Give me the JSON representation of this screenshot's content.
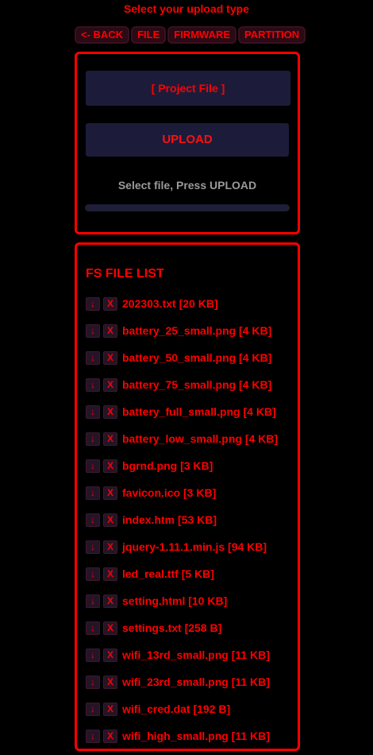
{
  "header": {
    "title": "Select your upload type"
  },
  "nav": {
    "back_label": "<- BACK",
    "file_label": "FILE",
    "firmware_label": "FIRMWARE",
    "partition_label": "PARTITION"
  },
  "upload": {
    "project_file_label": "[ Project File ]",
    "upload_label": "UPLOAD",
    "status": "Select file, Press UPLOAD",
    "progress_fraction": 0
  },
  "file_list": {
    "title": "FS FILE LIST",
    "download_label": "↓",
    "delete_label": "X",
    "files": [
      "202303.txt [20 KB]",
      "battery_25_small.png [4 KB]",
      "battery_50_small.png [4 KB]",
      "battery_75_small.png [4 KB]",
      "battery_full_small.png [4 KB]",
      "battery_low_small.png [4 KB]",
      "bgrnd.png [3 KB]",
      "favicon.ico [3 KB]",
      "index.htm [53 KB]",
      "jquery-1.11.1.min.js [94 KB]",
      "led_real.ttf [5 KB]",
      "setting.html [10 KB]",
      "settings.txt [258 B]",
      "wifi_13rd_small.png [11 KB]",
      "wifi_23rd_small.png [11 KB]",
      "wifi_cred.dat [192 B]",
      "wifi_high_small.png [11 KB]"
    ]
  },
  "colors": {
    "accent": "#ff0000",
    "background": "#000000",
    "button_bg": "#1c1c3a",
    "status_text": "#9a9a9a"
  }
}
